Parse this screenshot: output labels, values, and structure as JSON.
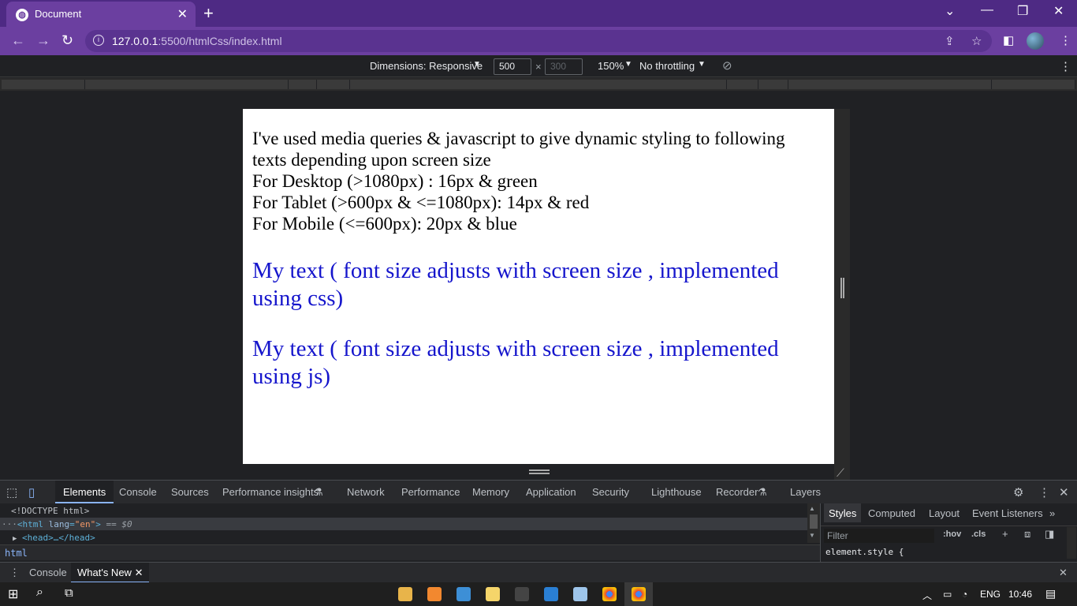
{
  "browser": {
    "tab_title": "Document",
    "tab_favicon": "globe-icon",
    "url_host": "127.0.0.1",
    "url_rest": ":5500/htmlCss/index.html",
    "accent_color": "#6b3fa0"
  },
  "device_toolbar": {
    "dimensions_label": "Dimensions: Responsive",
    "width_value": "500",
    "height_placeholder": "300",
    "times": "×",
    "zoom": "150%",
    "throttling": "No throttling"
  },
  "page": {
    "intro_line1": "I've used media queries & javascript to give dynamic styling to following texts depending upon screen size",
    "desktop_rule": "For Desktop (>1080px) : 16px & green",
    "tablet_rule": "For Tablet (>600px & <=1080px): 14px & red",
    "mobile_rule": "For Mobile (<=600px): 20px & blue",
    "css_text": "My text ( font size adjusts with screen size , implemented using css)",
    "js_text": "My text ( font size adjusts with screen size , implemented using js)",
    "text_color": "#1515cc"
  },
  "devtools": {
    "tabs": [
      "Elements",
      "Console",
      "Sources",
      "Performance insights",
      "Network",
      "Performance",
      "Memory",
      "Application",
      "Security",
      "Lighthouse",
      "Recorder",
      "Layers"
    ],
    "dom_line1": "<!DOCTYPE html>",
    "dom_html_open": "<html",
    "dom_attr_name": "lang",
    "dom_attr_value": "\"en\"",
    "dom_html_close": ">",
    "dom_selected_marker": "== $0",
    "dom_head": "<head>…</head>",
    "breadcrumb": "html",
    "styles_tabs": [
      "Styles",
      "Computed",
      "Layout",
      "Event Listeners"
    ],
    "filter_placeholder": "Filter",
    "hov": ":hov",
    "cls": ".cls",
    "element_style": "element.style {",
    "drawer_tabs": [
      "Console",
      "What's New"
    ]
  },
  "taskbar": {
    "language": "ENG",
    "time": "10:46"
  }
}
